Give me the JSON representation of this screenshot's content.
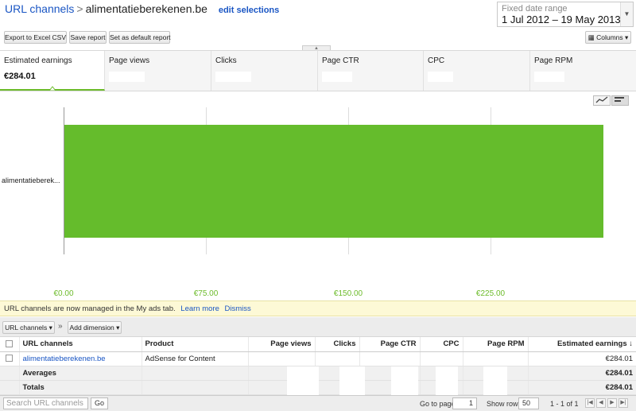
{
  "header": {
    "breadcrumb_root": "URL channels",
    "breadcrumb_sep": ">",
    "breadcrumb_current": "alimentatieberekenen.be",
    "edit_selections": "edit selections",
    "date_range_label": "Fixed date range",
    "date_range_value": "1 Jul 2012 – 19 May 2013"
  },
  "toolbar": {
    "export_csv": "Export to Excel CSV",
    "save_report": "Save report",
    "set_default": "Set as default report",
    "columns": "Columns"
  },
  "metrics": [
    {
      "label": "Estimated earnings",
      "value": "€284.01"
    },
    {
      "label": "Page views",
      "value": ""
    },
    {
      "label": "Clicks",
      "value": ""
    },
    {
      "label": "Page CTR",
      "value": ""
    },
    {
      "label": "CPC",
      "value": ""
    },
    {
      "label": "Page RPM",
      "value": ""
    }
  ],
  "chart_data": {
    "type": "bar",
    "orientation": "horizontal",
    "categories": [
      "alimentatieberek..."
    ],
    "values": [
      284.01
    ],
    "xlim": [
      0,
      300
    ],
    "tick_labels": [
      "€0.00",
      "€75.00",
      "€150.00",
      "€225.00"
    ],
    "tick_values": [
      0,
      75,
      150,
      225
    ],
    "grid": true,
    "bar_color": "#65bc2c"
  },
  "notice": {
    "text": "URL channels are now managed in the My ads tab.",
    "learn_more": "Learn more",
    "dismiss": "Dismiss"
  },
  "dimensions": {
    "primary": "URL channels",
    "chevrons": "»",
    "add_dimension": "Add dimension"
  },
  "table": {
    "headers": [
      "URL channels",
      "Product",
      "Page views",
      "Clicks",
      "Page CTR",
      "CPC",
      "Page RPM",
      "Estimated earnings ↓"
    ],
    "rows": [
      {
        "channel": "alimentatieberekenen.be",
        "product": "AdSense for Content",
        "earnings": "€284.01"
      }
    ],
    "averages_label": "Averages",
    "averages_earnings": "€284.01",
    "totals_label": "Totals",
    "totals_earnings": "€284.01"
  },
  "footer": {
    "search_placeholder": "Search URL channels",
    "go": "Go",
    "goto_label": "Go to page:",
    "goto_value": "1",
    "show_rows_label": "Show rows",
    "show_rows_value": "50",
    "range": "1 - 1 of 1"
  }
}
